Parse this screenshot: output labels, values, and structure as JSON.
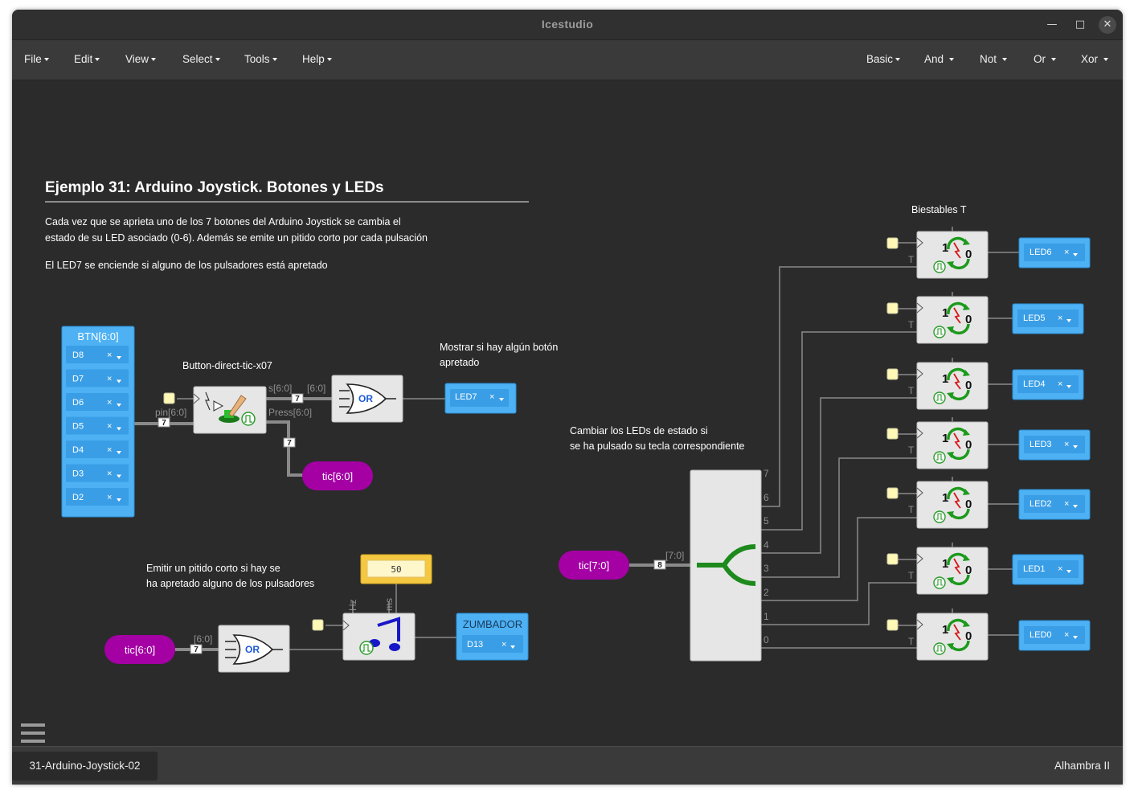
{
  "window": {
    "title": "Icestudio"
  },
  "menu": {
    "left": [
      "File",
      "Edit",
      "View",
      "Select",
      "Tools",
      "Help"
    ],
    "right": [
      "Basic",
      "And",
      "Not",
      "Or",
      "Xor"
    ]
  },
  "canvas": {
    "heading": "Ejemplo 31: Arduino Joystick. Botones y LEDs",
    "desc_line1": "Cada vez que se aprieta uno de los 7 botones del Arduino Joystick se cambia el",
    "desc_line2": "estado de su LED asociado (0-6). Además se emite un pitido corto por cada pulsación",
    "desc_line3": "El LED7 se enciende si alguno de los pulsadores está apretado",
    "note_button": "Button-direct-tic-x07",
    "note_show_1": "Mostrar si hay algún botón",
    "note_show_2": "apretado",
    "note_change_1": "Cambiar los LEDs de estado si",
    "note_change_2": "se ha pulsado su tecla correspondiente",
    "note_beep_1": "Emitir un pitido corto si hay se",
    "note_beep_2": "ha apretado alguno de los pulsadores",
    "note_bistables": "Biestables T",
    "btn_block": {
      "title": "BTN[6:0]",
      "pins": [
        "D8",
        "D7",
        "D6",
        "D5",
        "D4",
        "D3",
        "D2"
      ]
    },
    "led7": "LED7",
    "or_label": "OR",
    "labels": {
      "s": "s[6:0]",
      "s2": "[6:0]",
      "pin": "pin[6:0]",
      "press": "Press[6:0]",
      "t170": "[7:0]",
      "t60": "[6:0]",
      "hz": "Hz",
      "ms": "ms",
      "T": "T",
      "one": "1",
      "zero": "0"
    },
    "bus_widths": {
      "b1": "7",
      "b2": "7",
      "b3": "7",
      "b4": "8",
      "b5": "7"
    },
    "tags": {
      "tic1": "tic[6:0]",
      "tic2": "tic[7:0]",
      "tic3": "tic[6:0]"
    },
    "constant": "50",
    "buzzer": {
      "title": "ZUMBADOR",
      "pin": "D13"
    },
    "split_indices": [
      "7",
      "6",
      "5",
      "4",
      "3",
      "2",
      "1",
      "0"
    ],
    "leds": [
      "LED6",
      "LED5",
      "LED4",
      "LED3",
      "LED2",
      "LED1",
      "LED0"
    ],
    "x_mark": "×"
  },
  "footer": {
    "project": "31-Arduino-Joystick-02",
    "board": "Alhambra II"
  },
  "colors": {
    "accent_blue": "#4db1f4",
    "purple": "#a400a4",
    "yellow": "#f5c842",
    "block": "#e6e6e6",
    "wire": "#8a8a8a"
  }
}
